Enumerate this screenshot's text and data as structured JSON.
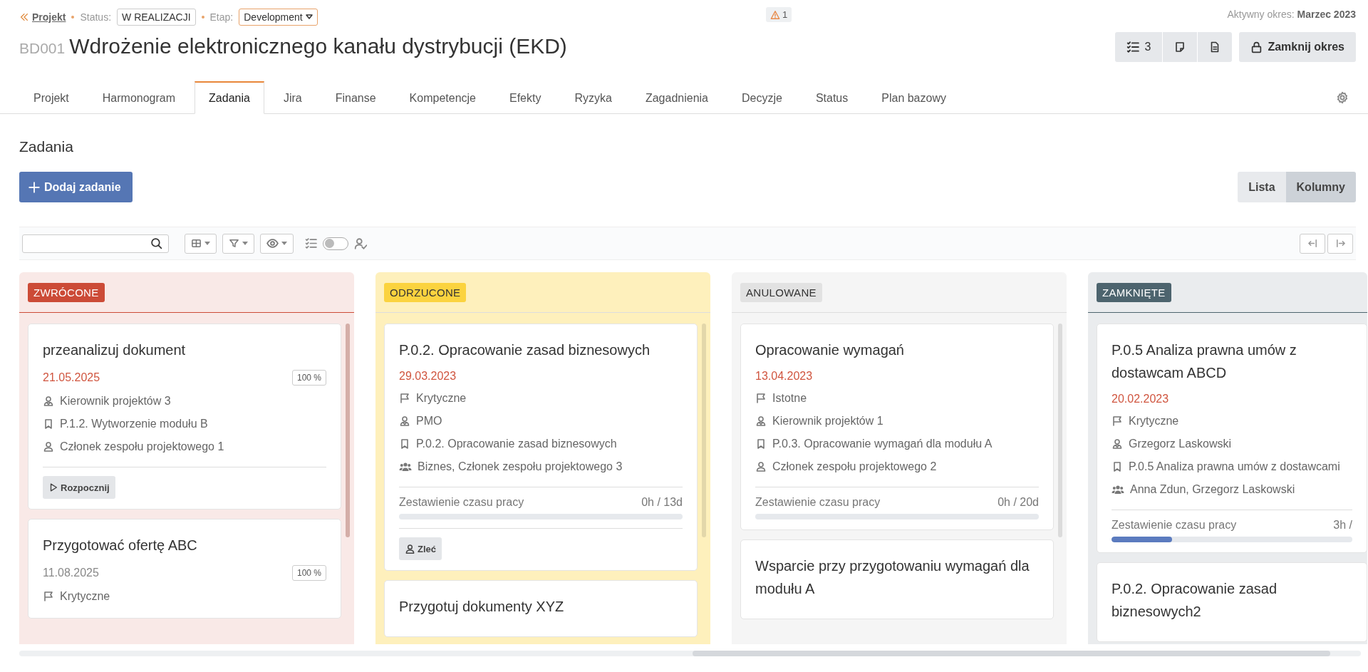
{
  "breadcrumb": {
    "back_link": "Projekt",
    "status_label": "Status:",
    "status": "W REALIZACJI",
    "stage_label": "Etap:",
    "stage": "Development"
  },
  "alert": {
    "count": "1"
  },
  "active_period": "Aktywny okres: **Marzec 2023**",
  "project": {
    "code": "BD001",
    "title": "Wdrożenie elektronicznego kanału dystrybucji (EKD)"
  },
  "actions": {
    "checklist_count": "3",
    "close_period": "Zamknij okres"
  },
  "tabs": [
    {
      "label": "Projekt",
      "selected": false
    },
    {
      "label": "Harmonogram",
      "selected": false
    },
    {
      "label": "Zadania",
      "selected": true
    },
    {
      "label": "Jira",
      "selected": false
    },
    {
      "label": "Finanse",
      "selected": false
    },
    {
      "label": "Kompetencje",
      "selected": false
    },
    {
      "label": "Efekty",
      "selected": false
    },
    {
      "label": "Ryzyka",
      "selected": false
    },
    {
      "label": "Zagadnienia",
      "selected": false
    },
    {
      "label": "Decyzje",
      "selected": false
    },
    {
      "label": "Status",
      "selected": false
    },
    {
      "label": "Plan bazowy",
      "selected": false
    }
  ],
  "section_title": "Zadania",
  "add_button": "Dodaj zadanie",
  "view_switch": [
    {
      "label": "Lista",
      "selected": false
    },
    {
      "label": "Kolumny",
      "selected": true
    }
  ],
  "toolbar": {
    "toggle_on": false
  },
  "columns": [
    {
      "title": "ZWRÓCONE",
      "color": "#cc4b37",
      "cards": [
        {
          "title": "przeanalizuj dokument",
          "date": "21.05.2025",
          "overdue": true,
          "percent": "100 %",
          "rows": [
            {
              "kind": "manager",
              "text": "Kierownik projektów 3"
            },
            {
              "kind": "task",
              "text": "P.1.2. Wytworzenie modułu B"
            },
            {
              "kind": "person",
              "text": "Członek zespołu projektowego 1"
            }
          ],
          "action": {
            "kind": "start",
            "label": "Rozpocznij"
          }
        },
        {
          "title": "Przygotować ofertę ABC",
          "date": "11.08.2025",
          "overdue": false,
          "percent": "100 %",
          "rows": [
            {
              "kind": "priority",
              "text": "Krytyczne"
            }
          ]
        }
      ]
    },
    {
      "title": "ODRZUCONE",
      "color": "#fbd33f",
      "cards": [
        {
          "title": "P.0.2. Opracowanie zasad biznesowych",
          "date": "29.03.2023",
          "overdue": true,
          "rows": [
            {
              "kind": "priority",
              "text": "Krytyczne"
            },
            {
              "kind": "manager",
              "text": "PMO"
            },
            {
              "kind": "task",
              "text": "P.0.2. Opracowanie zasad biznesowych"
            },
            {
              "kind": "team",
              "text": "Biznes, Członek zespołu projektowego 3"
            }
          ],
          "timesheet": {
            "label": "Zestawienie czasu pracy",
            "reading": "0h / 13d",
            "level": 0
          },
          "action": {
            "kind": "assign",
            "label": "Zleć"
          }
        },
        {
          "title": "Przygotuj dokumenty XYZ"
        }
      ]
    },
    {
      "title": "ANULOWANE",
      "color": "#e2e2e2",
      "cards": [
        {
          "title": "Opracowanie wymagań",
          "date": "13.04.2023",
          "overdue": true,
          "rows": [
            {
              "kind": "priority",
              "text": "Istotne"
            },
            {
              "kind": "manager",
              "text": "Kierownik projektów 1"
            },
            {
              "kind": "task",
              "text": "P.0.3. Opracowanie wymagań dla modułu A"
            },
            {
              "kind": "person",
              "text": "Członek zespołu projektowego 2"
            }
          ],
          "timesheet": {
            "label": "Zestawienie czasu pracy",
            "reading": "0h / 20d",
            "level": 0
          }
        },
        {
          "title": "Wsparcie przy przygotowaniu wymagań dla modułu A"
        }
      ]
    },
    {
      "title": "ZAMKNIĘTE",
      "color": "#4d646e",
      "cards": [
        {
          "title": "P.0.5 Analiza prawna umów z dostawcam ABCD",
          "date": "20.02.2023",
          "overdue": true,
          "rows": [
            {
              "kind": "priority",
              "text": "Krytyczne"
            },
            {
              "kind": "manager",
              "text": "Grzegorz Laskowski"
            },
            {
              "kind": "task",
              "text": "P.0.5 Analiza prawna umów z dostawcami"
            },
            {
              "kind": "team",
              "text": "Anna Zdun, Grzegorz Laskowski"
            }
          ],
          "timesheet": {
            "label": "Zestawienie czasu pracy",
            "reading": "3h /",
            "level": 0.25
          }
        },
        {
          "title": "P.0.2. Opracowanie zasad biznesowych2"
        }
      ]
    }
  ]
}
